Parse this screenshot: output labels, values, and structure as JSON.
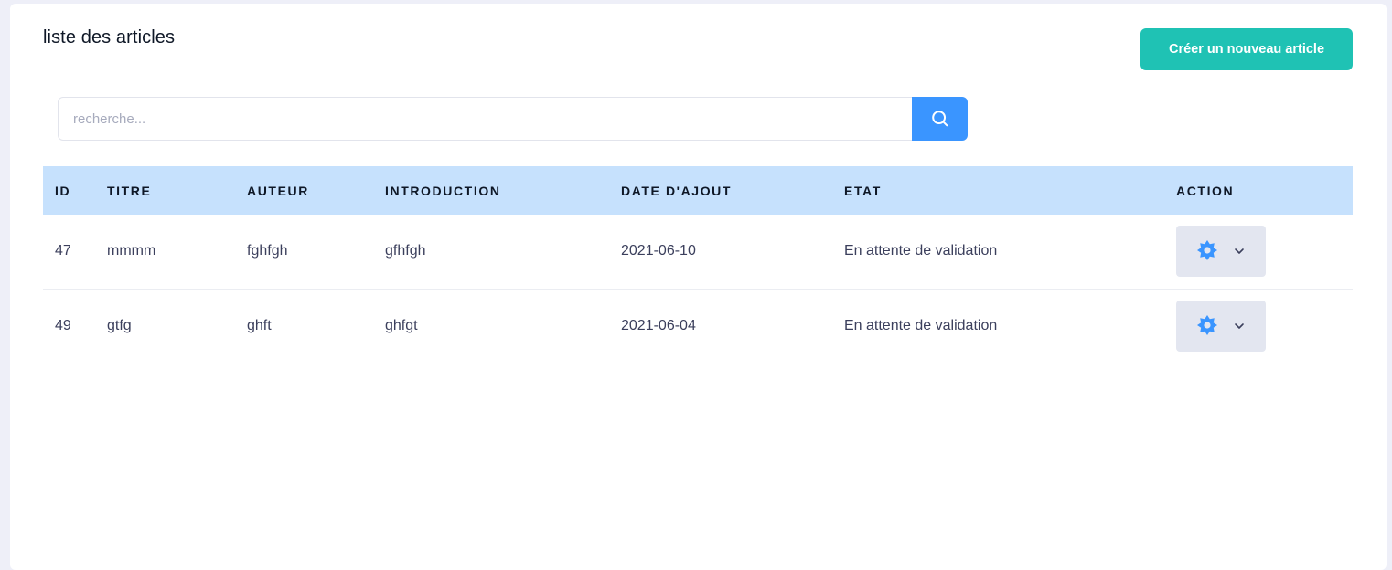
{
  "page": {
    "title": "liste des articles",
    "create_button_label": "Créer un nouveau article"
  },
  "search": {
    "placeholder": "recherche...",
    "value": "",
    "button_icon": "search-icon"
  },
  "table": {
    "headers": [
      "ID",
      "TITRE",
      "AUTEUR",
      "INTRODUCTION",
      "DATE D'AJOUT",
      "ETAT",
      "ACTION"
    ],
    "rows": [
      {
        "id": "47",
        "titre": "mmmm",
        "auteur": "fghfgh",
        "introduction": "gfhfgh",
        "date": "2021-06-10",
        "etat": "En attente de validation",
        "action_icon": "gear-icon"
      },
      {
        "id": "49",
        "titre": "gtfg",
        "auteur": "ghft",
        "introduction": "ghfgt",
        "date": "2021-06-04",
        "etat": "En attente de validation",
        "action_icon": "gear-icon"
      }
    ]
  },
  "colors": {
    "accent_teal": "#1fc2b4",
    "primary_blue": "#3a95ff",
    "header_bg": "#c6e1fd",
    "action_bg": "#e3e6f0"
  }
}
